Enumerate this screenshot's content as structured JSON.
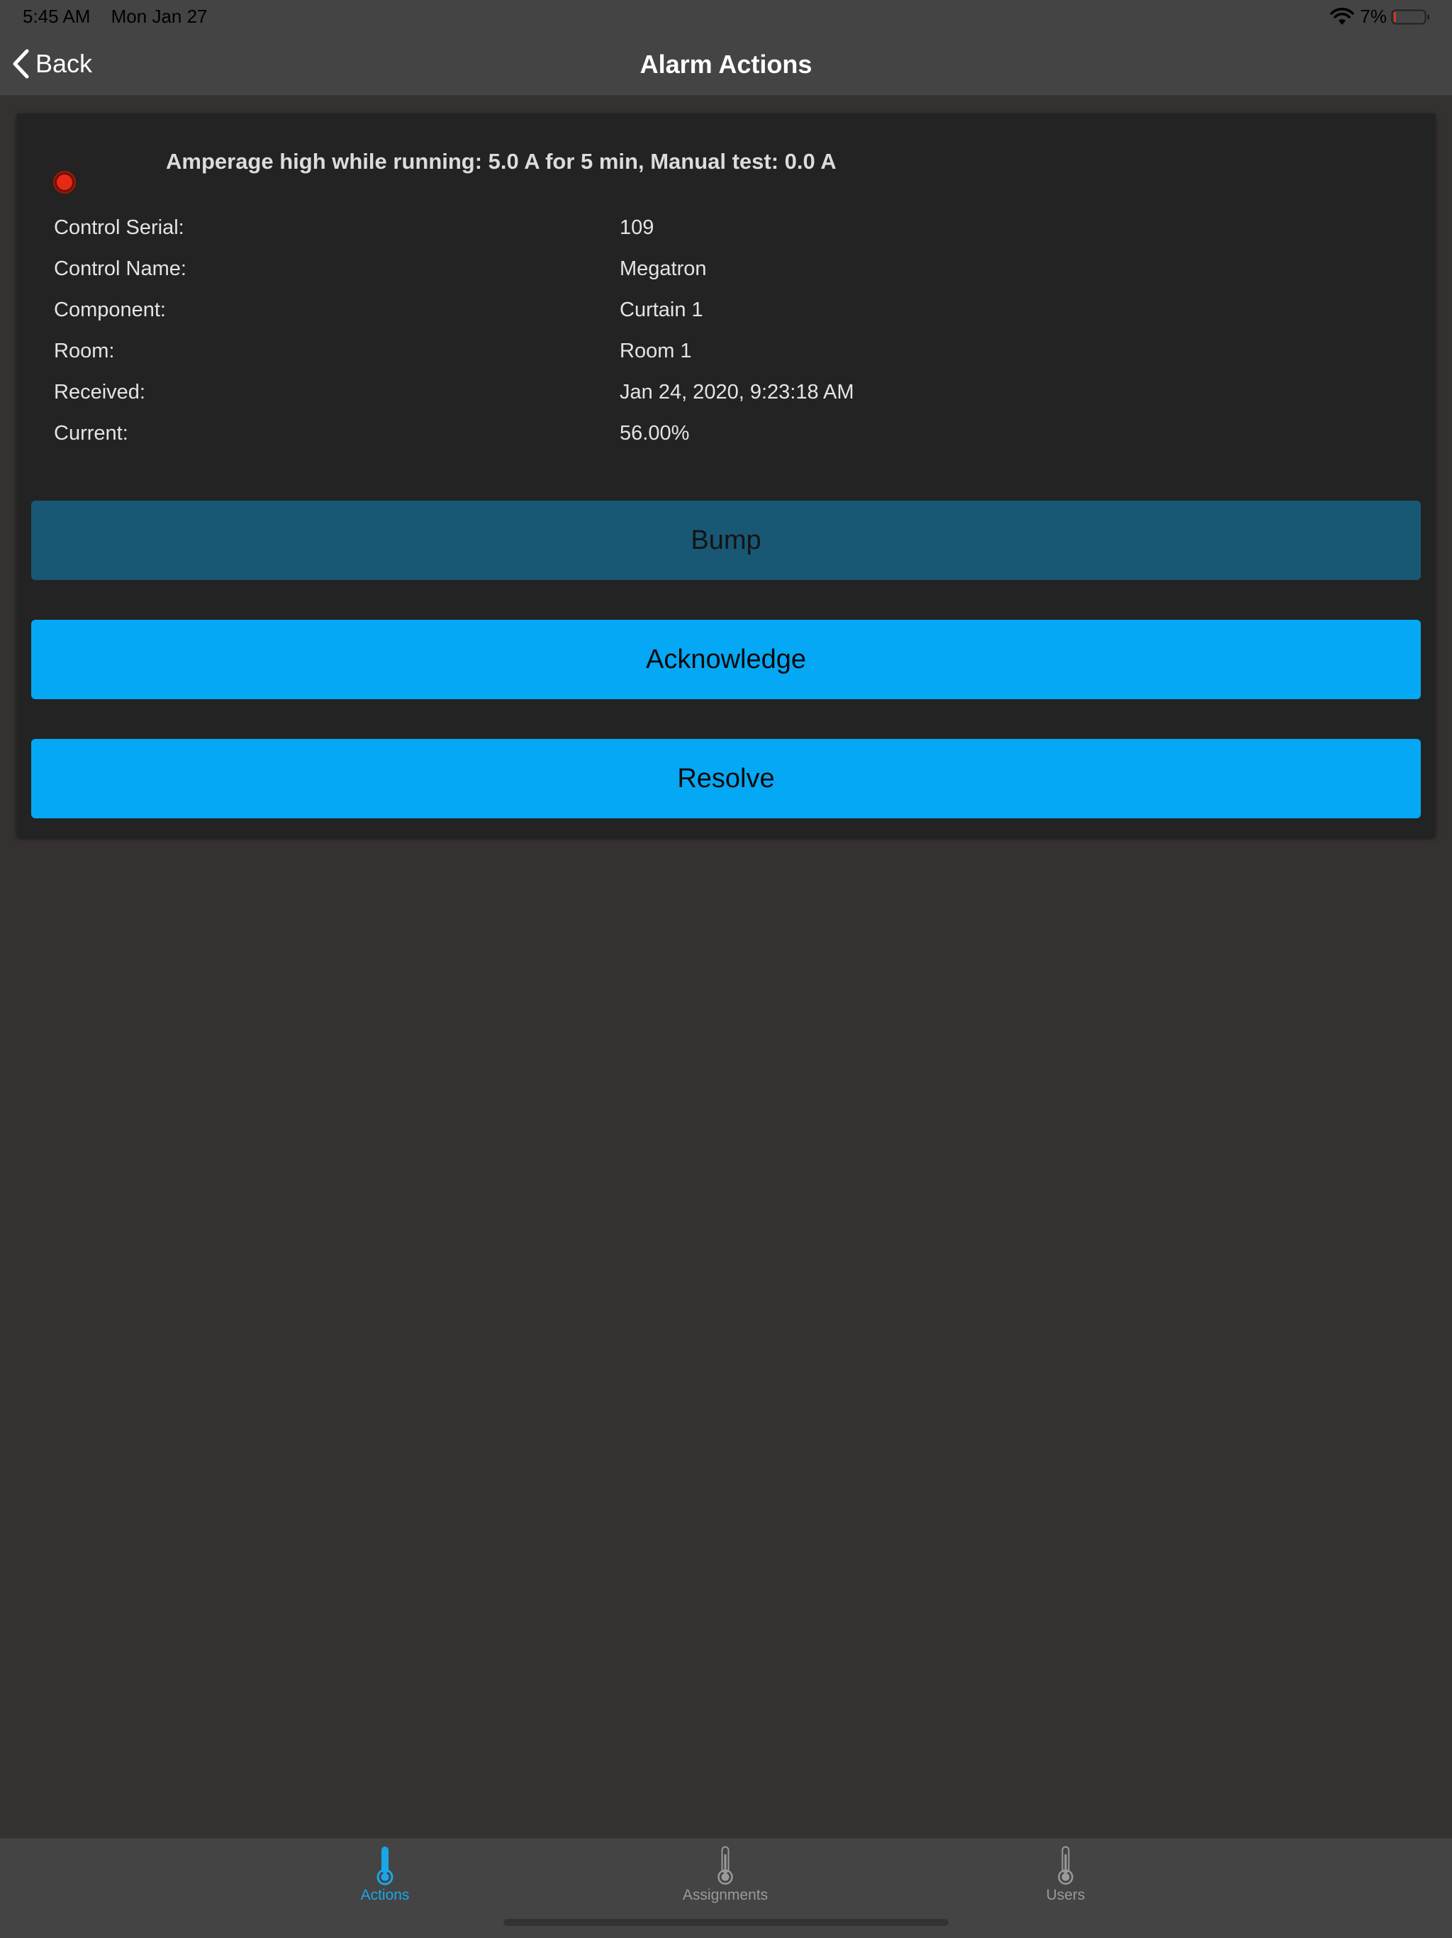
{
  "status_bar": {
    "time": "5:45 AM",
    "date": "Mon Jan 27",
    "battery_percent": "7%",
    "battery_level": 0.07
  },
  "nav": {
    "back_label": "Back",
    "title": "Alarm Actions"
  },
  "alarm": {
    "title": "Amperage high while running: 5.0 A for 5 min, Manual test: 0.0 A",
    "indicator_color": "#e52a16",
    "details": [
      {
        "label": "Control Serial:",
        "value": "109"
      },
      {
        "label": "Control Name:",
        "value": "Megatron"
      },
      {
        "label": "Component:",
        "value": "Curtain 1"
      },
      {
        "label": "Room:",
        "value": "Room 1"
      },
      {
        "label": "Received:",
        "value": "Jan 24, 2020, 9:23:18 AM"
      },
      {
        "label": "Current:",
        "value": "56.00%"
      }
    ]
  },
  "buttons": {
    "bump": "Bump",
    "acknowledge": "Acknowledge",
    "resolve": "Resolve"
  },
  "tabs": [
    {
      "label": "Actions",
      "icon": "thermometer-icon",
      "active": true
    },
    {
      "label": "Assignments",
      "icon": "thermometer-icon",
      "active": false
    },
    {
      "label": "Users",
      "icon": "thermometer-icon",
      "active": false
    }
  ],
  "colors": {
    "accent": "#05a8f4",
    "accent_dim": "#185874",
    "tab_active": "#1aa6e8",
    "tab_inactive": "#9a9a9a"
  }
}
